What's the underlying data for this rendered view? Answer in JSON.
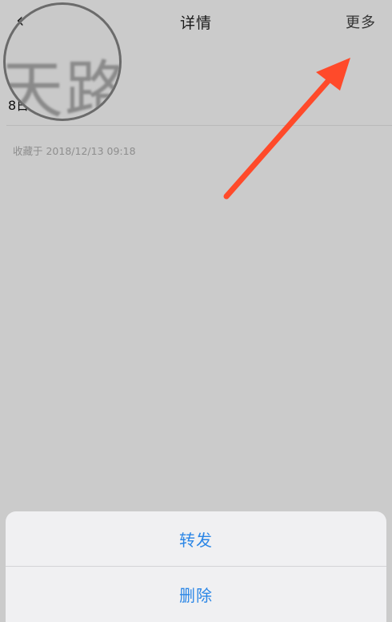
{
  "header": {
    "back_glyph": "‹",
    "title": "详情",
    "more_label": "更多"
  },
  "content": {
    "text": "8日",
    "magnified_text": "天路",
    "saved_info": "收藏于 2018/12/13 09:18"
  },
  "action_sheet": {
    "items": [
      {
        "label": "转发"
      },
      {
        "label": "删除"
      }
    ]
  },
  "colors": {
    "background": "#cbcbcb",
    "sheet_background": "#f0f0f2",
    "action_text": "#2b86e6",
    "arrow": "#ff4a2a"
  }
}
